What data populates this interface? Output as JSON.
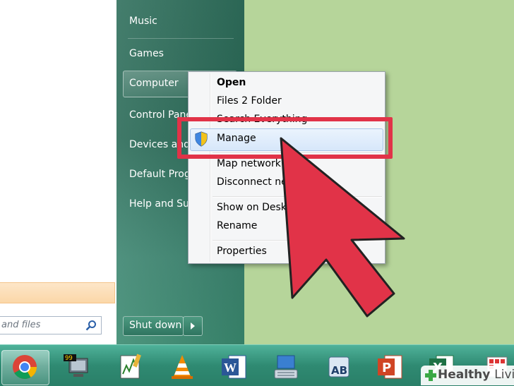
{
  "start_menu": {
    "search_placeholder": "and files",
    "right_items": [
      "Music",
      "Games",
      "Computer",
      "Control Panel",
      "Devices and",
      "Default Progr",
      "Help and Sup"
    ],
    "shutdown_label": "Shut down"
  },
  "context_menu": {
    "items": [
      "Open",
      "Files 2 Folder",
      "Search Everything",
      "Manage",
      "Map network d",
      "Disconnect net",
      "Show on Deskt",
      "Rename",
      "Properties"
    ]
  },
  "watermark": {
    "prefix": "Healthy",
    "suffix": "Living"
  },
  "colors": {
    "highlight_red": "#e13348",
    "background_green": "#b6d59a",
    "start_menu_green": "#2f6f5c"
  },
  "icons": {
    "taskbar": [
      "chrome-icon",
      "monitor-99-icon",
      "graph-editor-icon",
      "vlc-cone-icon",
      "word-icon",
      "keyboard-icon",
      "ab-icon",
      "powerpoint-icon",
      "excel-icon",
      "grid-icon"
    ]
  }
}
